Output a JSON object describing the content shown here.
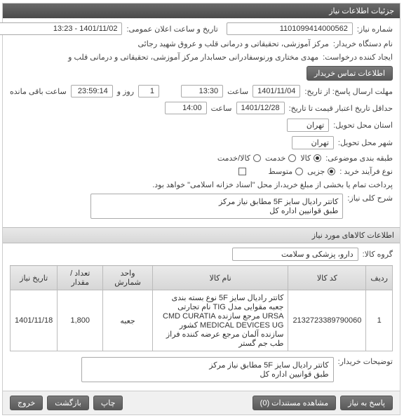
{
  "header": {
    "title": "جزئیات اطلاعات نیاز"
  },
  "fields": {
    "need_number_label": "شماره نیاز:",
    "need_number": "1101099414000562",
    "announce_label": "تاریخ و ساعت اعلان عمومی:",
    "announce_value": "1401/11/02 - 13:23",
    "buyer_label": "نام دستگاه خریدار:",
    "buyer_value": "مرکز آموزشی، تحقیقاتی و درمانی قلب و عروق شهید رجائی",
    "requester_label": "ایجاد کننده درخواست:",
    "requester_value": "مهدی مختاری ورنوسفادرانی حسابدار مرکز آموزشی، تحقیقاتی و درمانی قلب و",
    "contact_btn": "اطلاعات تماس خریدار",
    "deadline_label": "مهلت ارسال پاسخ: از تاریخ:",
    "deadline_date": "1401/11/04",
    "time_label": "ساعت",
    "deadline_time": "13:30",
    "time_left": "23:59:14",
    "day_label": "روز و",
    "days_left": "1",
    "remain_label": "ساعت باقی مانده",
    "validity_label": "حداقل تاریخ اعتبار قیمت تا تاریخ:",
    "validity_date": "1401/12/28",
    "validity_time": "14:00",
    "delivery_city_label": "استان محل تحویل:",
    "delivery_city": "تهران",
    "delivery_town_label": "شهر محل تحویل:",
    "delivery_town": "تهران",
    "subject_label": "طبقه بندی موضوعی:",
    "subject_opts": {
      "kala": "کالا",
      "khadmat": "خدمت",
      "kala_khadmat": "کالا/خدمت"
    },
    "process_label": "نوع فرآیند خرید :",
    "process_opts": {
      "jozei": "جزیی",
      "motavaset": "متوسط"
    },
    "process_note": "پرداخت تمام یا بخشی از مبلغ خرید،از محل \"اسناد خزانه اسلامی\" خواهد بود.",
    "desc_label": "شرح کلی نیاز:",
    "desc_value": "کاتتر رادیال سایز 5F مطابق نیاز مرکز\nطبق قوانیین اداره کل"
  },
  "items_header": "اطلاعات کالاهای مورد نیاز",
  "group_label": "گروه کالا:",
  "group_value": "دارو، پزشکی و سلامت",
  "table": {
    "headers": [
      "ردیف",
      "کد کالا",
      "نام کالا",
      "واحد شمارش",
      "تعداد / مقدار",
      "تاریخ نیاز"
    ],
    "row": {
      "idx": "1",
      "code": "2132723389790060",
      "name": "کاتتر رادیال سایز 5F نوع بسته بندی جعبه مقوایی مدل TIG نام تجارتی URSA مرجع سازنده CMD CURATIA MEDICAL DEVICES UG کشور سازنده آلمان مرجع عرضه کننده فراز طب جم گستر",
      "unit": "جعبه",
      "qty": "1,800",
      "date": "1401/11/18"
    }
  },
  "buyer_desc_label": "توضیحات خریدار:",
  "buyer_desc_value": "کاتتر رادیال سایز 5F مطابق نیاز مرکز\nطبق قوانیین اداره کل",
  "footer": {
    "respond": "پاسخ به نیاز",
    "view_docs": "مشاهده مستندات (0)",
    "print": "چاپ",
    "back": "بازگشت",
    "exit": "خروج"
  }
}
